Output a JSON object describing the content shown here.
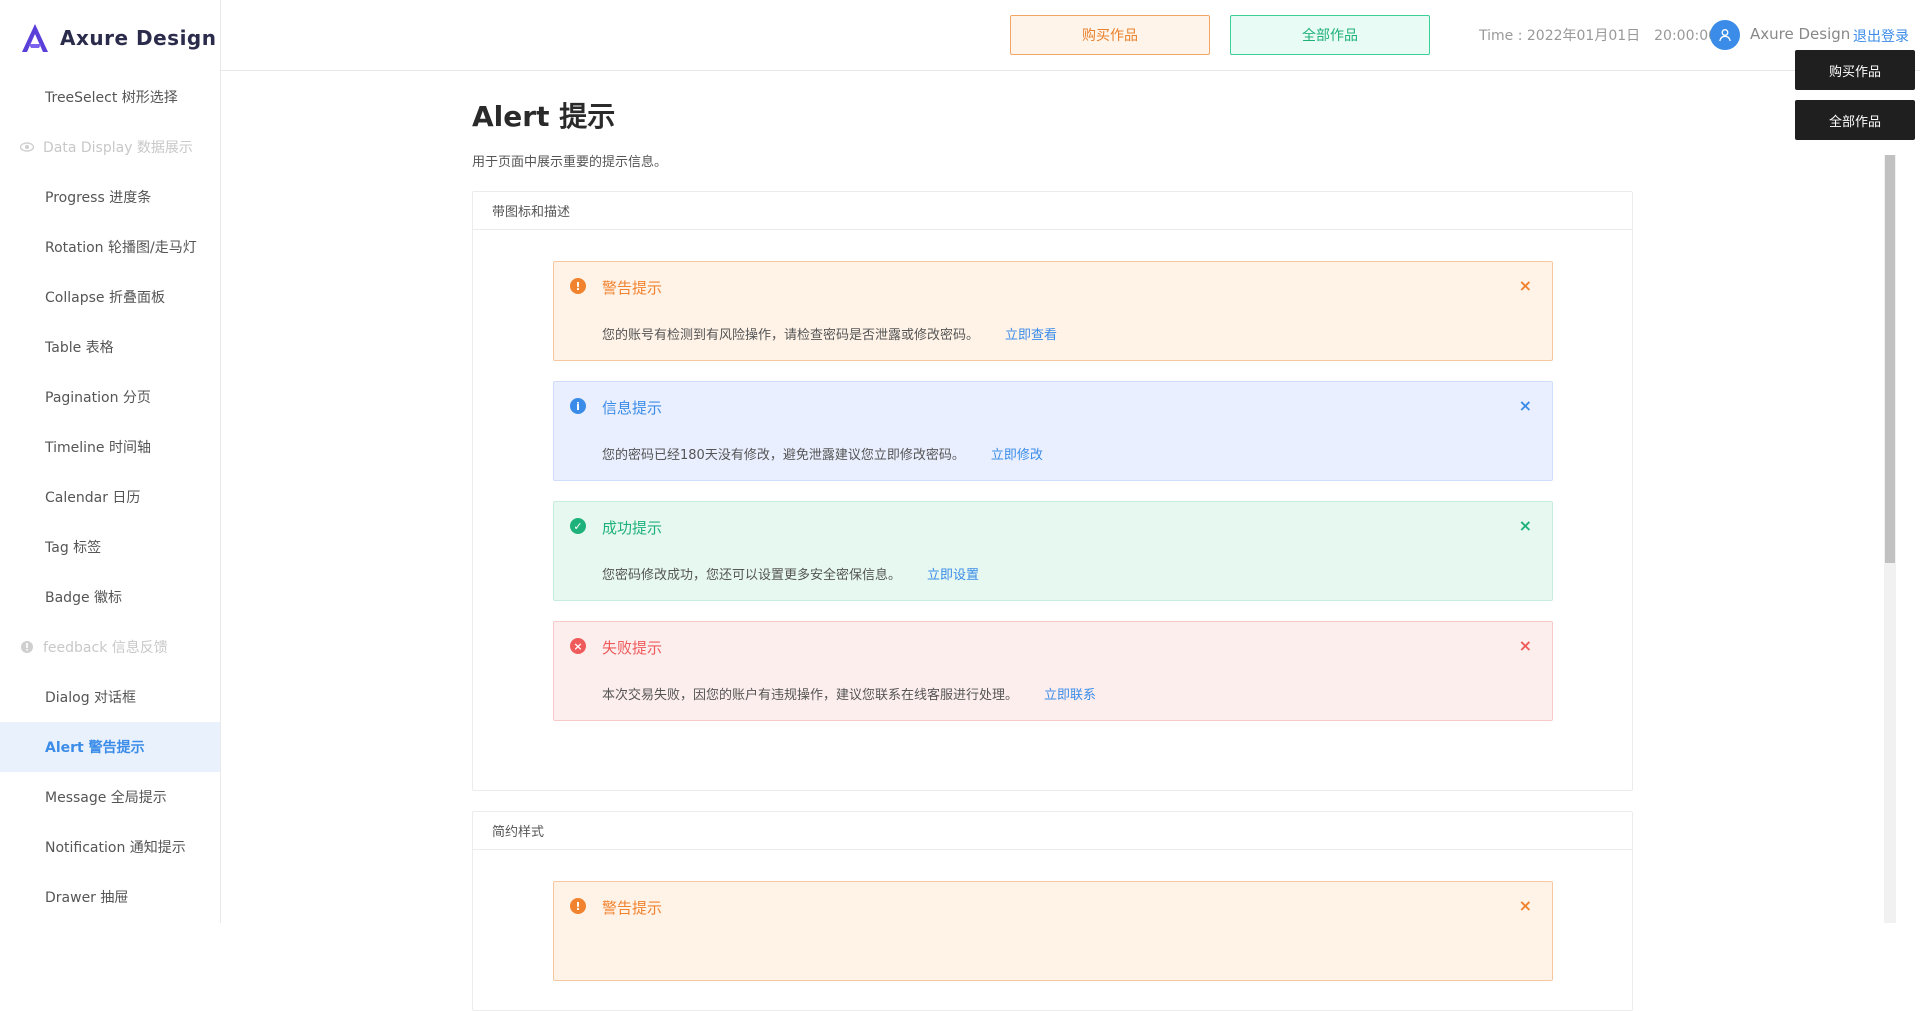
{
  "app": {
    "logo_text": "Axure Design"
  },
  "sidebar": {
    "items": [
      {
        "label": "TreeSelect 树形选择",
        "type": "item"
      },
      {
        "label": "Data Display 数据展示",
        "type": "group",
        "icon": "eye-icon"
      },
      {
        "label": "Progress 进度条",
        "type": "item"
      },
      {
        "label": "Rotation 轮播图/走马灯",
        "type": "item"
      },
      {
        "label": "Collapse 折叠面板",
        "type": "item"
      },
      {
        "label": "Table 表格",
        "type": "item"
      },
      {
        "label": "Pagination 分页",
        "type": "item"
      },
      {
        "label": "Timeline 时间轴",
        "type": "item"
      },
      {
        "label": "Calendar 日历",
        "type": "item"
      },
      {
        "label": "Tag 标签",
        "type": "item"
      },
      {
        "label": "Badge 徽标",
        "type": "item"
      },
      {
        "label": "feedback 信息反馈",
        "type": "group",
        "icon": "info-circle-icon"
      },
      {
        "label": "Dialog 对话框",
        "type": "item"
      },
      {
        "label": "Alert 警告提示",
        "type": "item",
        "active": true
      },
      {
        "label": "Message 全局提示",
        "type": "item"
      },
      {
        "label": "Notification 通知提示",
        "type": "item"
      },
      {
        "label": "Drawer 抽屉",
        "type": "item"
      }
    ]
  },
  "header": {
    "buy_label": "购买作品",
    "all_label": "全部作品",
    "time_label": "Time : 2022年01月01日",
    "clock": "20:00:00",
    "username": "Axure Design",
    "logout_label": "退出登录"
  },
  "float_buttons": {
    "buy": "购买作品",
    "all": "全部作品"
  },
  "page": {
    "title": "Alert 提示",
    "description": "用于页面中展示重要的提示信息。"
  },
  "cards": {
    "with_icon": {
      "title": "带图标和描述",
      "alerts": [
        {
          "kind": "warn",
          "title": "警告提示",
          "desc": "您的账号有检测到有风险操作，请检查密码是否泄露或修改密码。",
          "link": "立即查看"
        },
        {
          "kind": "info",
          "title": "信息提示",
          "desc": "您的密码已经180天没有修改，避免泄露建议您立即修改密码。",
          "link": "立即修改"
        },
        {
          "kind": "succ",
          "title": "成功提示",
          "desc": "您密码修改成功，您还可以设置更多安全密保信息。",
          "link": "立即设置"
        },
        {
          "kind": "err",
          "title": "失败提示",
          "desc": "本次交易失败，因您的账户有违规操作，建议您联系在线客服进行处理。",
          "link": "立即联系"
        }
      ]
    },
    "simple": {
      "title": "简约样式",
      "alerts": [
        {
          "kind": "warn",
          "title": "警告提示"
        }
      ]
    }
  },
  "colors": {
    "accent": "#3b8ce8",
    "warn": "#f1822e",
    "success": "#1fb17a",
    "error": "#ef5a5a"
  }
}
